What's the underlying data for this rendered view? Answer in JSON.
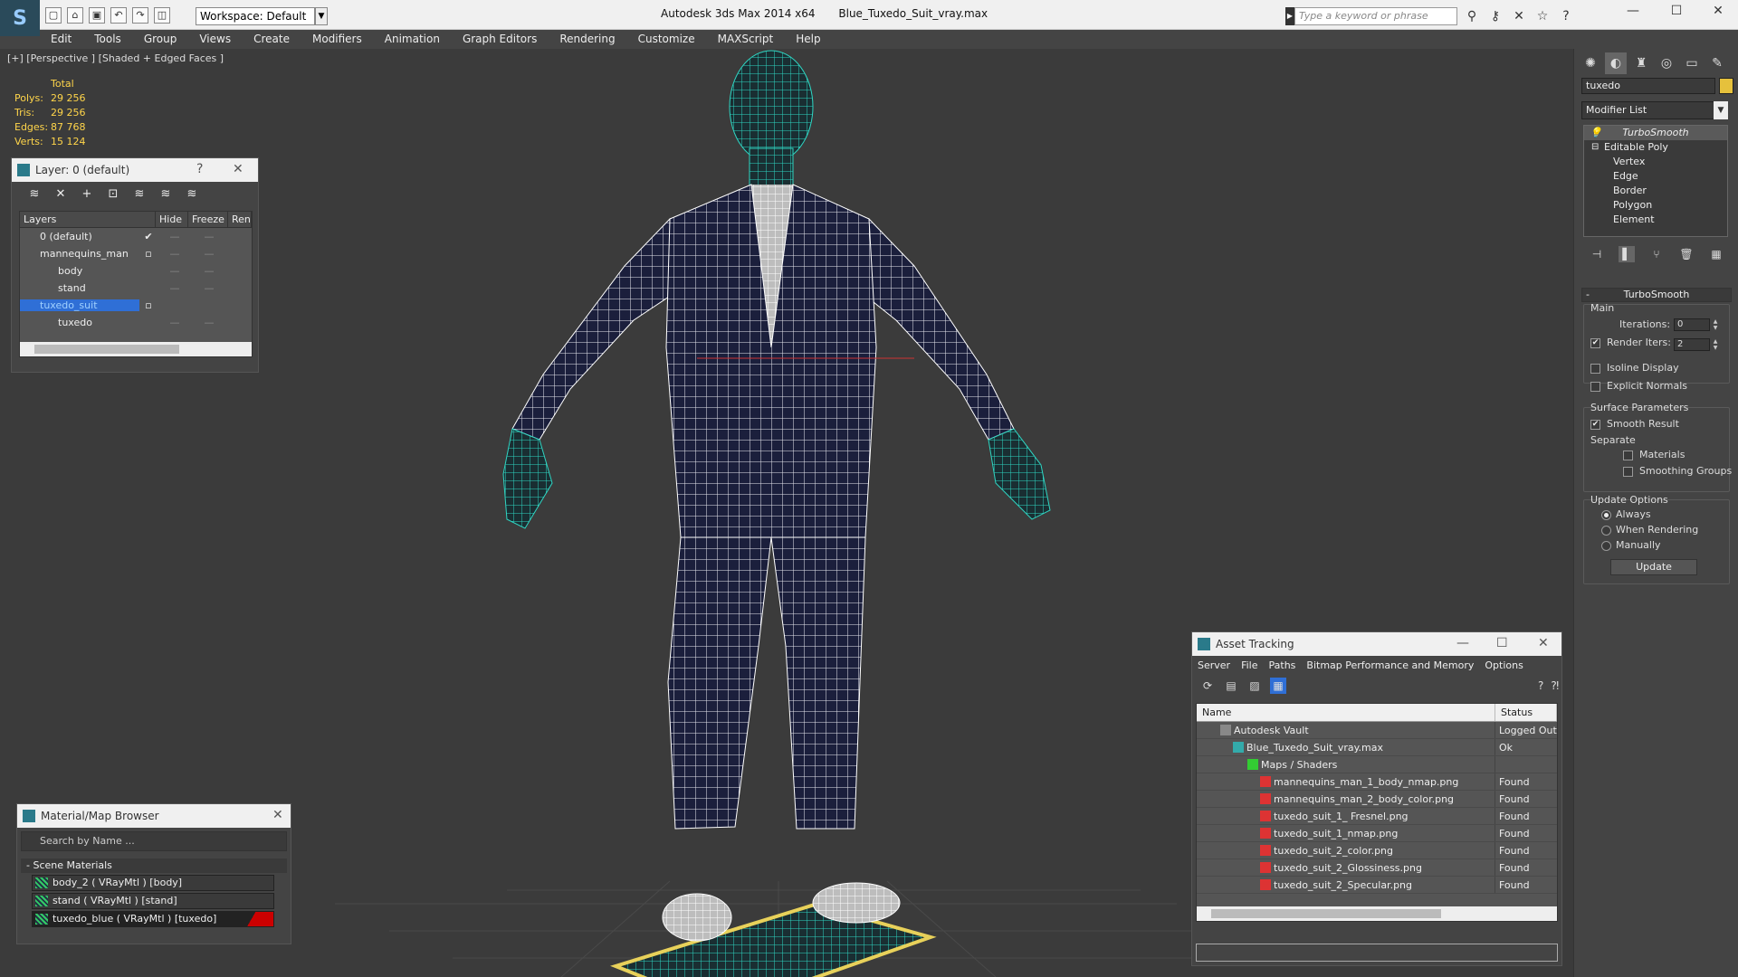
{
  "titlebar": {
    "workspace": "Workspace: Default",
    "app": "Autodesk 3ds Max  2014 x64",
    "file": "Blue_Tuxedo_Suit_vray.max",
    "search_placeholder": "Type a keyword or phrase"
  },
  "menu": [
    "Edit",
    "Tools",
    "Group",
    "Views",
    "Create",
    "Modifiers",
    "Animation",
    "Graph Editors",
    "Rendering",
    "Customize",
    "MAXScript",
    "Help"
  ],
  "viewport": {
    "label": "[+] [Perspective ] [Shaded + Edged Faces ]",
    "stats": {
      "header": "Total",
      "rows": [
        {
          "label": "Polys:",
          "value": "29 256"
        },
        {
          "label": "Tris:",
          "value": "29 256"
        },
        {
          "label": "Edges:",
          "value": "87 768"
        },
        {
          "label": "Verts:",
          "value": "15 124"
        }
      ]
    }
  },
  "layer_panel": {
    "title": "Layer: 0 (default)",
    "help": "?",
    "columns": [
      "Layers",
      "Hide",
      "Freeze",
      "Rend"
    ],
    "rows": [
      {
        "name": "0 (default)"
      },
      {
        "name": "mannequins_man"
      },
      {
        "name": "body"
      },
      {
        "name": "stand"
      },
      {
        "name": "tuxedo_suit"
      },
      {
        "name": "tuxedo"
      }
    ]
  },
  "material_browser": {
    "title": "Material/Map Browser",
    "search_placeholder": "Search by Name ...",
    "section": "- Scene Materials",
    "items": [
      {
        "label": "body_2  ( VRayMtl ) [body]"
      },
      {
        "label": "stand  ( VRayMtl ) [stand]"
      },
      {
        "label": "tuxedo_blue  ( VRayMtl ) [tuxedo]"
      }
    ]
  },
  "command_panel": {
    "object_name": "tuxedo",
    "object_color": "#e6c13c",
    "modifier_list": "Modifier List",
    "stack": [
      {
        "label": "TurboSmooth"
      },
      {
        "label": "Editable Poly"
      },
      {
        "label": "Vertex"
      },
      {
        "label": "Edge"
      },
      {
        "label": "Border"
      },
      {
        "label": "Polygon"
      },
      {
        "label": "Element"
      }
    ],
    "turbosmooth": {
      "title": "TurboSmooth",
      "main": "Main",
      "iterations_label": "Iterations:",
      "iterations": "0",
      "render_iters_label": "Render Iters:",
      "render_iters": "2",
      "isoline": "Isoline Display",
      "explicit_normals": "Explicit Normals",
      "surface_params": "Surface Parameters",
      "smooth_result": "Smooth Result",
      "separate": "Separate",
      "materials": "Materials",
      "smoothing_groups": "Smoothing Groups",
      "update_options": "Update Options",
      "always": "Always",
      "when_rendering": "When Rendering",
      "manually": "Manually",
      "update": "Update"
    }
  },
  "asset_tracking": {
    "title": "Asset Tracking",
    "menu": [
      "Server",
      "File",
      "Paths",
      "Bitmap Performance and Memory",
      "Options"
    ],
    "columns": [
      "Name",
      "Status"
    ],
    "rows": [
      {
        "name": "Autodesk Vault",
        "status": "Logged Out"
      },
      {
        "name": "Blue_Tuxedo_Suit_vray.max",
        "status": "Ok"
      },
      {
        "name": "Maps / Shaders",
        "status": ""
      },
      {
        "name": "mannequins_man_1_body_nmap.png",
        "status": "Found"
      },
      {
        "name": "mannequins_man_2_body_color.png",
        "status": "Found"
      },
      {
        "name": "tuxedo_suit_1_ Fresnel.png",
        "status": "Found"
      },
      {
        "name": "tuxedo_suit_1_nmap.png",
        "status": "Found"
      },
      {
        "name": "tuxedo_suit_2_color.png",
        "status": "Found"
      },
      {
        "name": "tuxedo_suit_2_Glossiness.png",
        "status": "Found"
      },
      {
        "name": "tuxedo_suit_2_Specular.png",
        "status": "Found"
      }
    ]
  },
  "icons": {
    "logo": "3ds-max-logo-icon",
    "scene_accent": "#2fd5c2",
    "suit_color": "#1b1f3c",
    "stand_color": "#e8d15a"
  }
}
